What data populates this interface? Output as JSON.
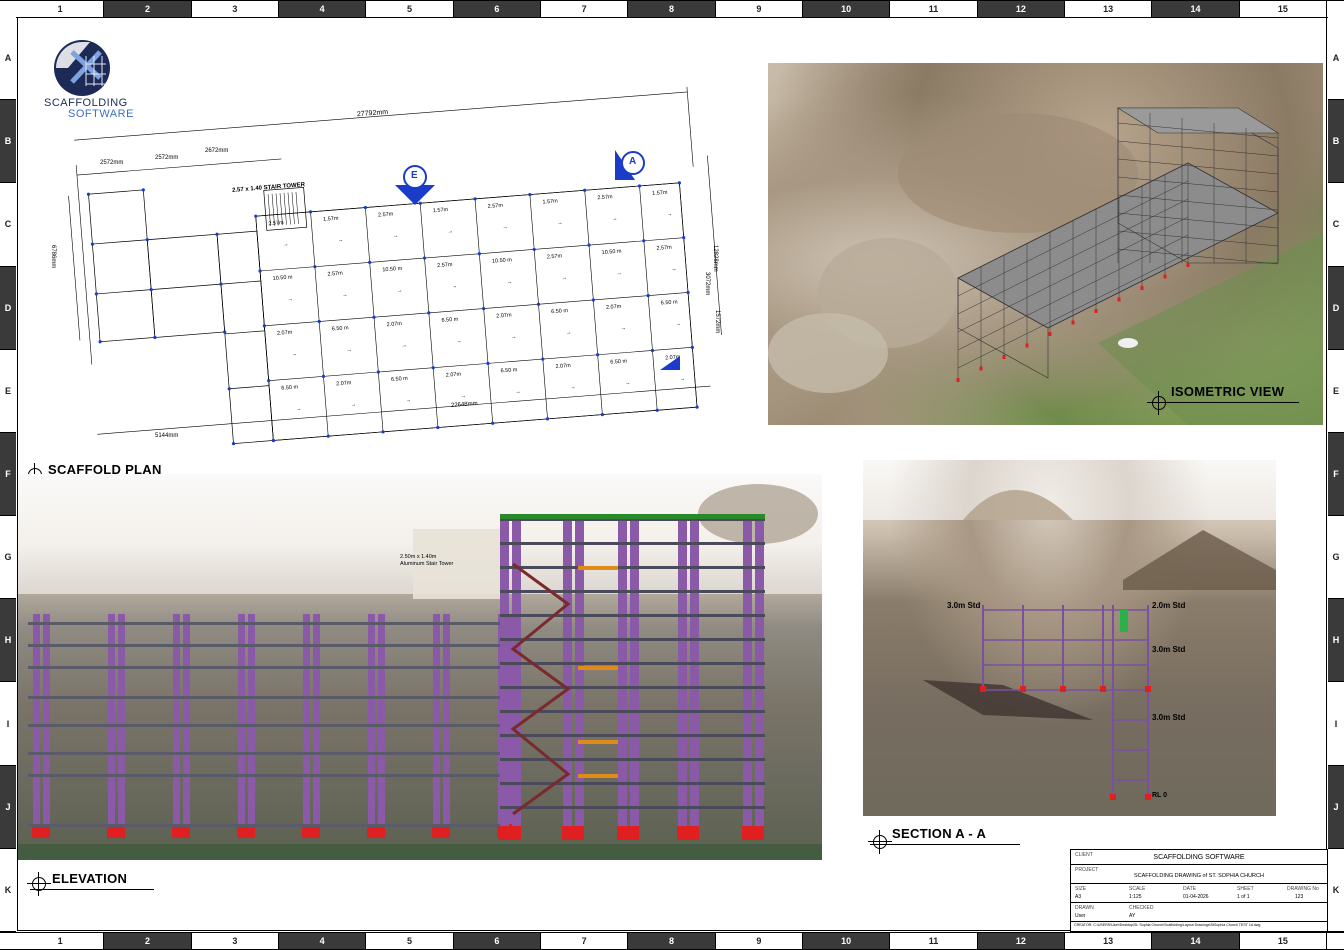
{
  "frame": {
    "columns": [
      "1",
      "2",
      "3",
      "4",
      "5",
      "6",
      "7",
      "8",
      "9",
      "10",
      "11",
      "12",
      "13",
      "14",
      "15"
    ],
    "rows": [
      "A",
      "B",
      "C",
      "D",
      "E",
      "F",
      "G",
      "H",
      "I",
      "J",
      "K"
    ]
  },
  "logo": {
    "line1": "SCAFFOLDING",
    "line2": "SOFTWARE"
  },
  "plan": {
    "label": "SCAFFOLD PLAN",
    "dim_overall_top": "27792mm",
    "dim_top_1": "2572mm",
    "dim_top_2": "2572mm",
    "dim_top_3": "2672mm",
    "dim_bottom": "22648mm",
    "dim_bottom_left": "5144mm",
    "dim_left": "6786mm",
    "dim_right_1": "12828mm",
    "dim_right_2": "3072mm",
    "dim_right_3": "1572mm",
    "stair_label": "2.57 x 1.40 STAIR TOWER",
    "marker_e": "E",
    "marker_a": "A",
    "bay_labels": [
      "2.57m",
      "10.50 m",
      "2.07m",
      "6.50 m",
      "1.57m",
      "2.57m",
      "6.50 m",
      "2.07m"
    ]
  },
  "iso": {
    "label": "ISOMETRIC VIEW"
  },
  "elevation": {
    "label": "ELEVATION",
    "stair_note_1": "2.50m x 1.40m",
    "stair_note_2": "Aluminum Stair Tower"
  },
  "section": {
    "label": "SECTION A - A",
    "std_1": "3.0m Std",
    "std_2": "2.0m Std",
    "std_3": "3.0m Std",
    "std_4": "3.0m Std",
    "level": "RL 0"
  },
  "title_block": {
    "client_hdr": "CLIENT",
    "client": "SCAFFOLDING SOFTWARE",
    "project_hdr": "PROJECT",
    "project": "SCAFFOLDING DRAWING of ST. SOPHIA CHURCH",
    "size_hdr": "SIZE",
    "size": "A3",
    "scale_hdr": "SCALE",
    "scale": "1:125",
    "date_hdr": "DATE",
    "date": "01-04-2026",
    "sheet_hdr": "SHEET",
    "sheet": "1  of  1",
    "drawing_hdr": "DRAWING No",
    "drawing": "123",
    "drawn_hdr": "DRAWN",
    "drawn": "User",
    "checked_hdr": "CHECKED",
    "checked": "AY",
    "filepath": "CREATOR: C:\\USERS\\User\\Desktop\\St. Sophia Church\\Scaffolding\\Layout Drawings\\StSophia Church TEST 1d.dwg"
  },
  "colors": {
    "frame_dark": "#3a3a3a",
    "scaffold_purple": "#8a5aa8",
    "base_red": "#e02020",
    "plan_blue": "#1a3cc8"
  }
}
